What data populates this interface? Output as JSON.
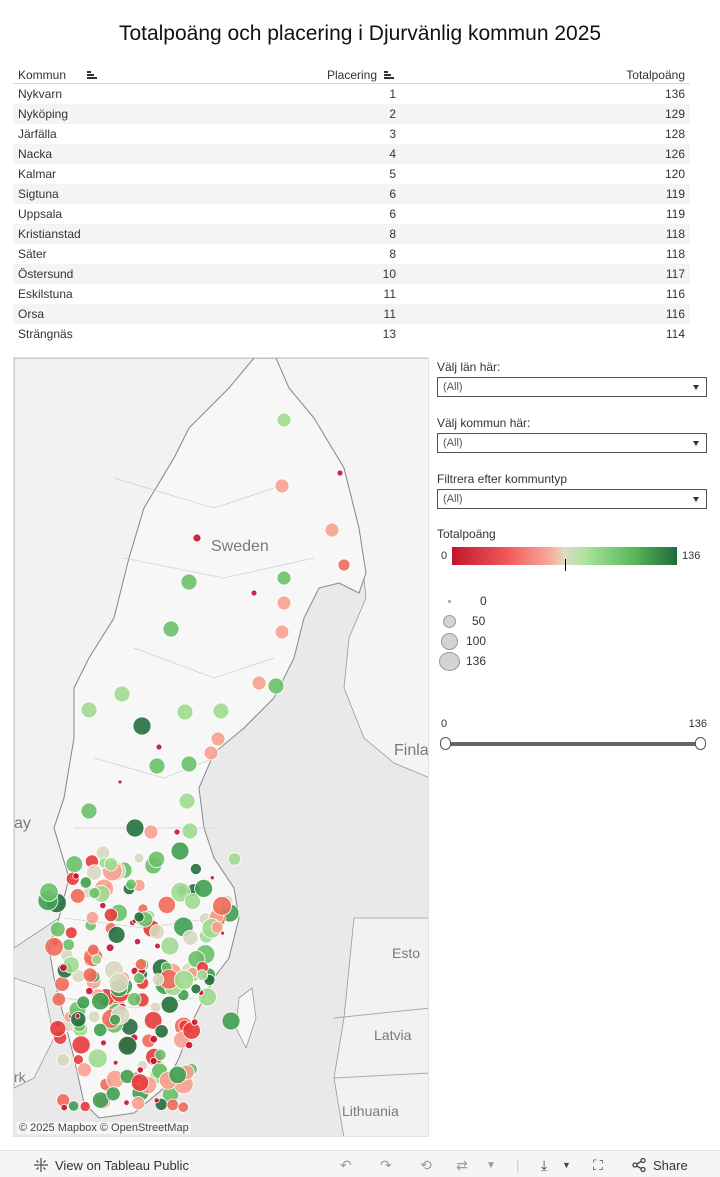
{
  "title": "Totalpoäng och placering i Djurvänlig kommun 2025",
  "table": {
    "headers": {
      "kommun": "Kommun",
      "placering": "Placering",
      "totalpoang": "Totalpoäng"
    },
    "rows": [
      {
        "kommun": "Nykvarn",
        "placering": "1",
        "totalpoang": "136"
      },
      {
        "kommun": "Nyköping",
        "placering": "2",
        "totalpoang": "129"
      },
      {
        "kommun": "Järfälla",
        "placering": "3",
        "totalpoang": "128"
      },
      {
        "kommun": "Nacka",
        "placering": "4",
        "totalpoang": "126"
      },
      {
        "kommun": "Kalmar",
        "placering": "5",
        "totalpoang": "120"
      },
      {
        "kommun": "Sigtuna",
        "placering": "6",
        "totalpoang": "119"
      },
      {
        "kommun": "Uppsala",
        "placering": "6",
        "totalpoang": "119"
      },
      {
        "kommun": "Kristianstad",
        "placering": "8",
        "totalpoang": "118"
      },
      {
        "kommun": "Säter",
        "placering": "8",
        "totalpoang": "118"
      },
      {
        "kommun": "Östersund",
        "placering": "10",
        "totalpoang": "117"
      },
      {
        "kommun": "Eskilstuna",
        "placering": "11",
        "totalpoang": "116"
      },
      {
        "kommun": "Orsa",
        "placering": "11",
        "totalpoang": "116"
      },
      {
        "kommun": "Strängnäs",
        "placering": "13",
        "totalpoang": "114"
      }
    ]
  },
  "map": {
    "labels": {
      "sweden": "Sweden",
      "finland": "Finla",
      "norway": "ay",
      "estonia": "Esto",
      "latvia": "Latvia",
      "lithuania": "Lithuania",
      "denmark": "rk"
    },
    "attribution": "© 2025 Mapbox  © OpenStreetMap"
  },
  "filters": {
    "lan": {
      "label": "Välj län här:",
      "value": "(All)"
    },
    "kommun": {
      "label": "Välj kommun här:",
      "value": "(All)"
    },
    "kommuntyp": {
      "label": "Filtrera efter kommuntyp",
      "value": "(All)"
    }
  },
  "color_legend": {
    "title": "Totalpoäng",
    "min": "0",
    "max": "136",
    "colors": {
      "low": "#c2172e",
      "mid": "#dcdcc8",
      "high": "#1f6b3c"
    }
  },
  "size_legend": [
    "0",
    "50",
    "100",
    "136"
  ],
  "slider": {
    "min": "0",
    "max": "136",
    "range_low": 0,
    "range_high": 136
  },
  "footer": {
    "view_label": "View on Tableau Public",
    "share_label": "Share"
  }
}
